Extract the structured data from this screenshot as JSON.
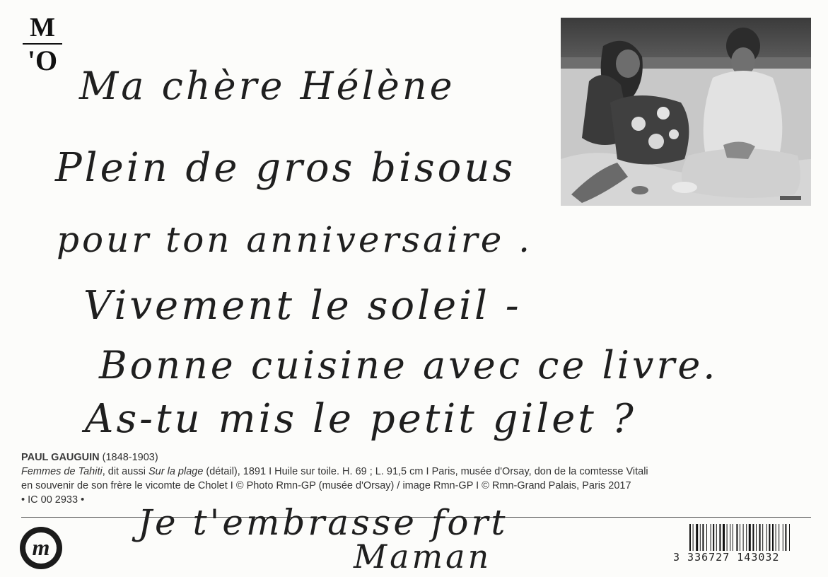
{
  "logo": {
    "top": "M",
    "bottom": "'O"
  },
  "seal_letter": "m",
  "handwriting": {
    "line1": "Ma chère Hélène",
    "line2": "Plein de gros bisous",
    "line3": "pour ton anniversaire .",
    "line4": "Vivement le soleil -",
    "line5": "Bonne cuisine avec ce livre.",
    "line6": "As-tu mis le petit gilet ?",
    "line7": "Je t'embrasse fort",
    "line8": "Maman"
  },
  "caption": {
    "artist": "PAUL GAUGUIN",
    "dates": " (1848-1903)",
    "title": "Femmes de Tahiti",
    "dit": ", dit aussi ",
    "alt_title": "Sur la plage",
    "details": " (détail), 1891 I Huile sur toile. H. 69 ; L. 91,5 cm I Paris, musée d'Orsay, don de la comtesse Vitali",
    "line3": "en souvenir de son frère le vicomte de Cholet I © Photo Rmn-GP (musée d'Orsay) / image Rmn-GP I © Rmn-Grand Palais, Paris 2017",
    "ref": "• IC 00 2933 •"
  },
  "barcode": {
    "digits": "3 336727 143032"
  }
}
